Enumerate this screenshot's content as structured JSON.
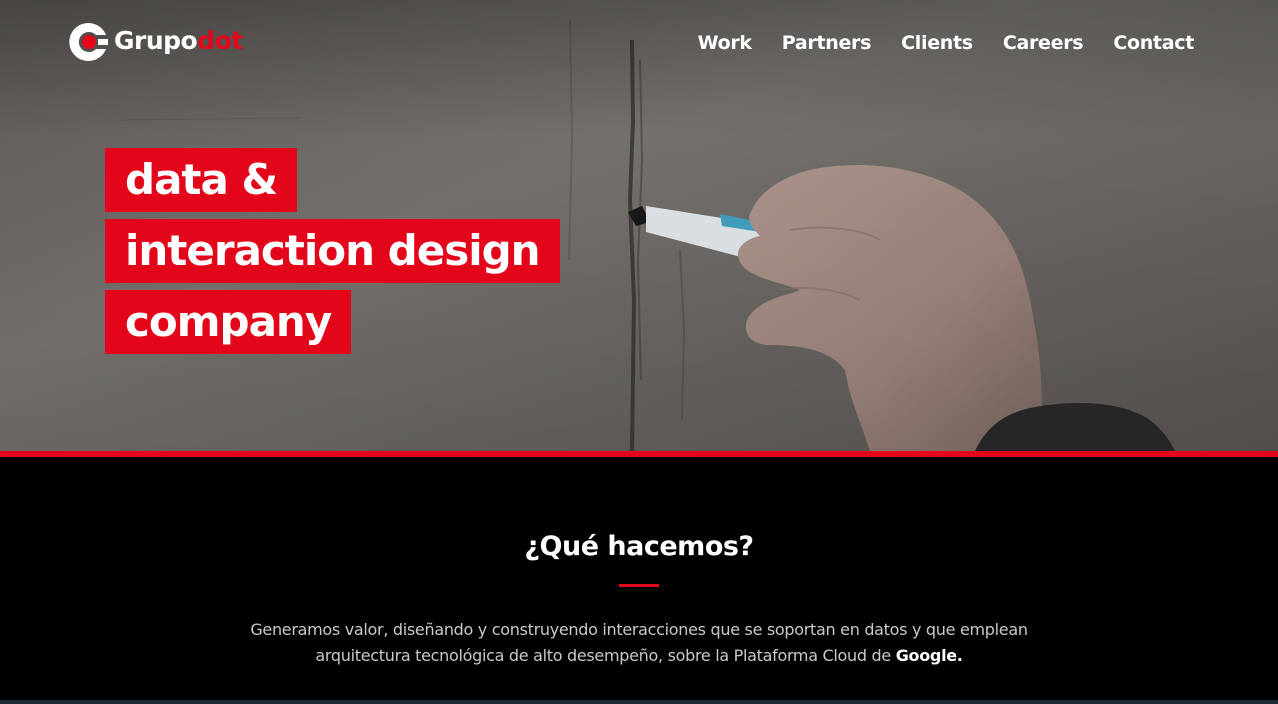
{
  "brand": {
    "name_primary": "Grupo",
    "name_accent": "dot",
    "accent_color": "#e3061b"
  },
  "nav": {
    "items": [
      {
        "label": "Work"
      },
      {
        "label": "Partners"
      },
      {
        "label": "Clients"
      },
      {
        "label": "Careers"
      },
      {
        "label": "Contact"
      }
    ]
  },
  "hero": {
    "headline_lines": [
      "data &",
      "interaction design",
      "company"
    ]
  },
  "about": {
    "title": "¿Qué hacemos?",
    "body_text": "Generamos valor, diseñando y construyendo interacciones que se soportan en datos y que emplean arquitectura tecnológica de alto desempeño, sobre la Plataforma Cloud de",
    "body_highlight": "Google."
  },
  "colors": {
    "primary_red": "#e3061b",
    "section_bg": "#000000",
    "text_light": "#ffffff",
    "text_muted": "#c9c9c9"
  },
  "icons": {
    "logo": "grupodot-logo-icon"
  }
}
